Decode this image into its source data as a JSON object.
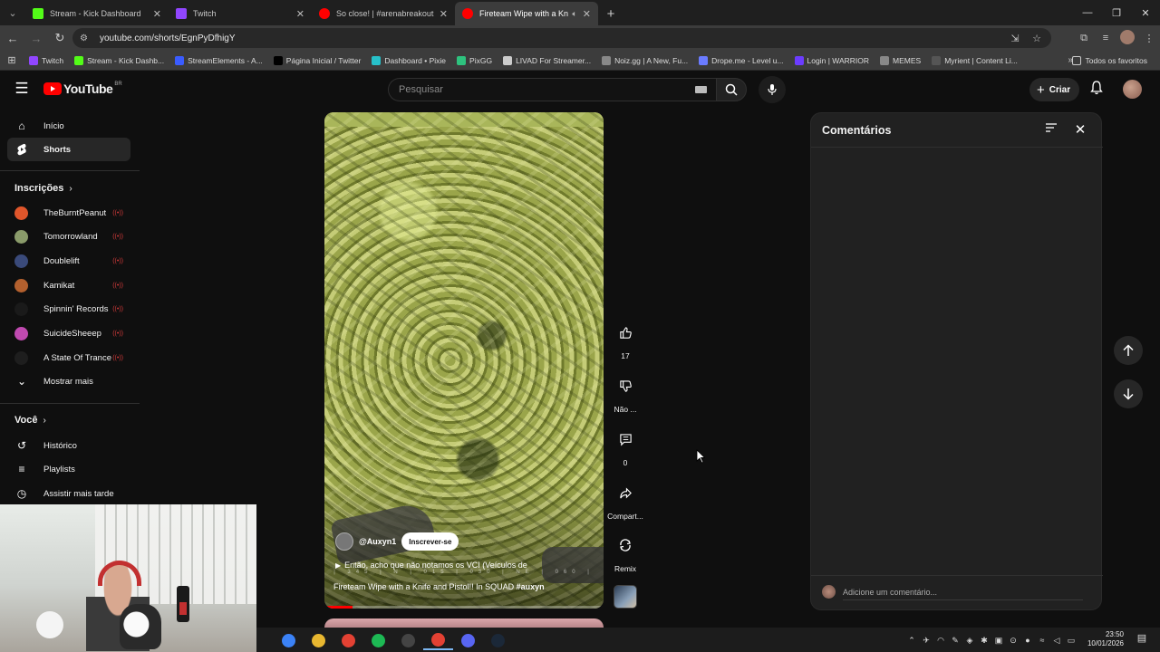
{
  "browser": {
    "tabs": [
      {
        "title": "Stream - Kick Dashboard",
        "color": "#53fc18"
      },
      {
        "title": "Twitch",
        "color": "#9146ff"
      },
      {
        "title": "So close! | #arenabreakoutinfin",
        "color": "#ff0000"
      },
      {
        "title": "Fireteam Wipe with a Knife",
        "color": "#ff0000",
        "active": true
      }
    ],
    "url": "youtube.com/shorts/EgnPyDfhigY",
    "bookmarks": [
      {
        "label": "Twitch",
        "color": "#9146ff"
      },
      {
        "label": "Stream - Kick Dashb...",
        "color": "#53fc18"
      },
      {
        "label": "StreamElements - A...",
        "color": "#3a5cff"
      },
      {
        "label": "Página Inicial / Twitter",
        "color": "#000000"
      },
      {
        "label": "Dashboard • Pixie",
        "color": "#27c0c9"
      },
      {
        "label": "PixGG",
        "color": "#2ec27e"
      },
      {
        "label": "LIVAD For Streamer...",
        "color": "#cccccc"
      },
      {
        "label": "Noiz.gg | A New, Fu...",
        "color": "#888888"
      },
      {
        "label": "Drope.me - Level u...",
        "color": "#6a7bff"
      },
      {
        "label": "Login | WARRIOR",
        "color": "#6c3cff"
      },
      {
        "label": "MEMES",
        "color": "#888888"
      },
      {
        "label": "Myrient | Content Li...",
        "color": "#555555"
      }
    ],
    "all_bookmarks": "Todos os favoritos"
  },
  "youtube": {
    "logo": "YouTube",
    "logo_region": "BR",
    "search_placeholder": "Pesquisar",
    "create_label": "Criar",
    "sidebar": {
      "home": "Início",
      "shorts": "Shorts",
      "subscriptions_header": "Inscrições",
      "channels": [
        {
          "name": "TheBurntPeanut",
          "color": "#e0562b"
        },
        {
          "name": "Tomorrowland",
          "color": "#8a9b6a"
        },
        {
          "name": "Doublelift",
          "color": "#3a4a7a"
        },
        {
          "name": "Kamikat",
          "color": "#b3602e"
        },
        {
          "name": "Spinnin' Records",
          "color": "#1a1a1a"
        },
        {
          "name": "SuicideSheeep",
          "color": "#c04ab0"
        },
        {
          "name": "A State Of Trance",
          "color": "#1e1e1e"
        }
      ],
      "show_more": "Mostrar mais",
      "you_header": "Você",
      "history": "Histórico",
      "playlists": "Playlists",
      "watch_later": "Assistir mais tarde"
    },
    "short": {
      "channel": "@Auxyn1",
      "subscribe": "Inscrever-se",
      "description": "Então, acho que não notamos os VCI (Veículos de",
      "title": "Fireteam Wipe with a Knife and Pistol!! In SQUAD",
      "hashtag": "#auxyn",
      "compass": "| 345 | N | 015 | 030 | NE | 060 |",
      "progress": 0.1
    },
    "actions": {
      "likes": "17",
      "dislike_label": "Não ...",
      "comments": "0",
      "share_label": "Compart...",
      "remix_label": "Remix"
    },
    "comments_panel": {
      "title": "Comentários",
      "input_placeholder": "Adicione um comentário..."
    }
  },
  "taskbar": {
    "apps": [
      {
        "name": "copilot",
        "color": "#3b82f6"
      },
      {
        "name": "explorer",
        "color": "#e8b730"
      },
      {
        "name": "chrome",
        "color": "#e34133"
      },
      {
        "name": "spotify",
        "color": "#1db954"
      },
      {
        "name": "obs",
        "color": "#444444"
      },
      {
        "name": "chrome-active",
        "color": "#e34133"
      },
      {
        "name": "discord",
        "color": "#5865f2"
      },
      {
        "name": "steam",
        "color": "#1b2838"
      }
    ],
    "time": "23:50",
    "date": "10/01/2026"
  }
}
